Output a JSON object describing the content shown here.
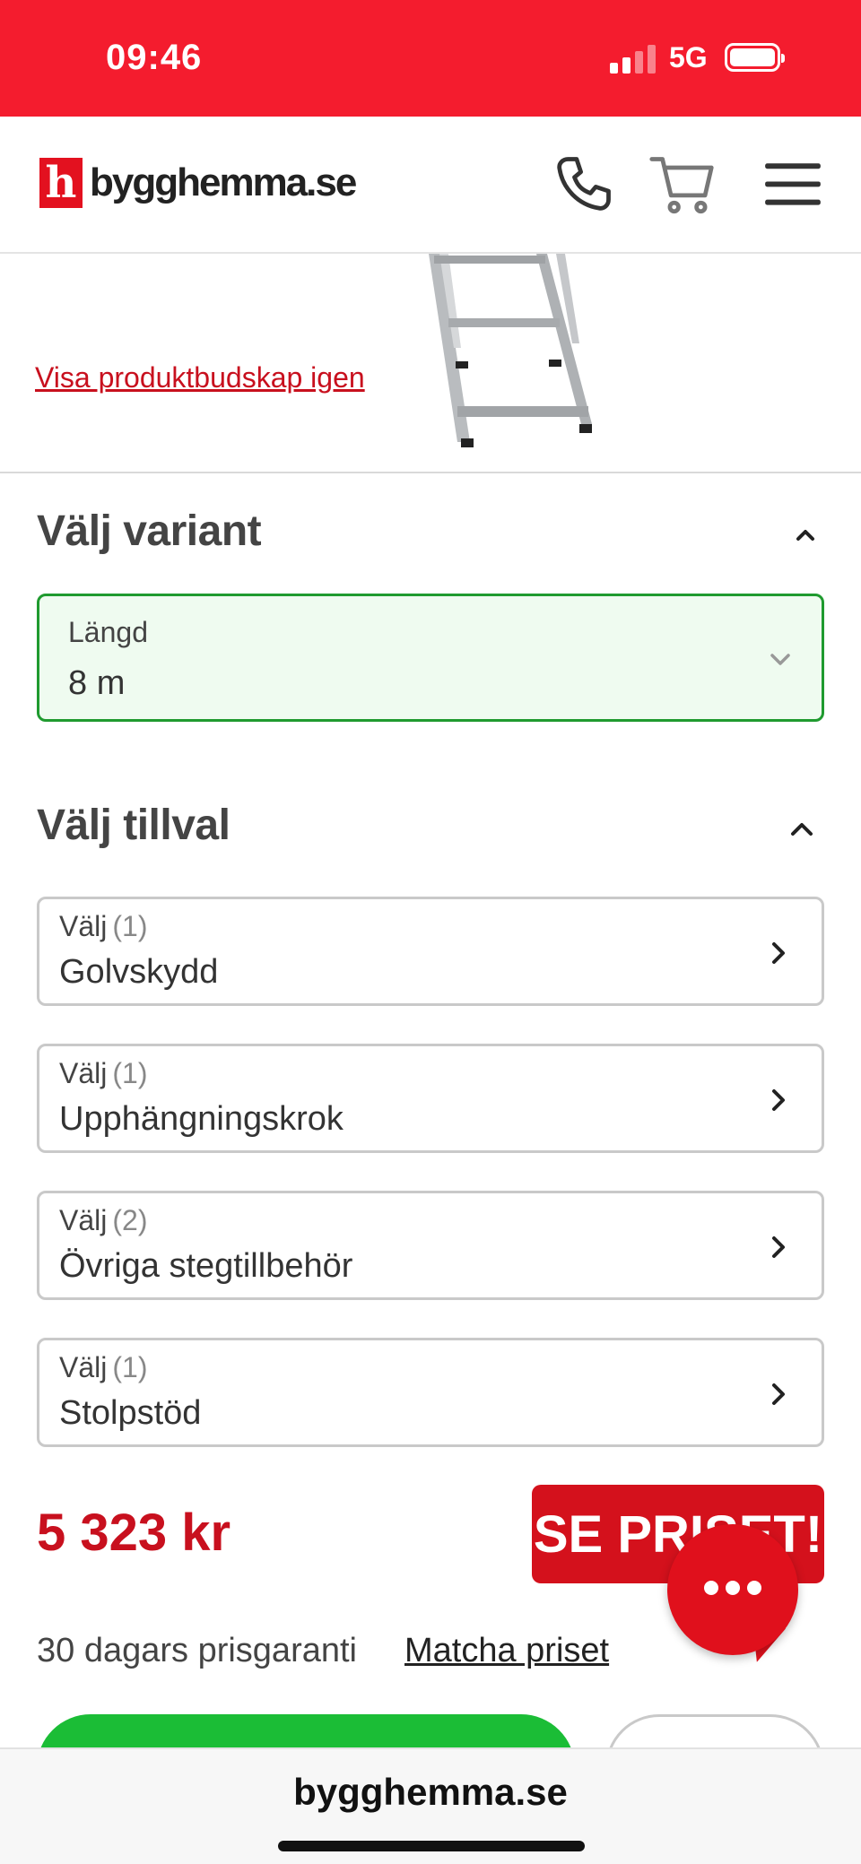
{
  "status_bar": {
    "time": "09:46",
    "network": "5G"
  },
  "header": {
    "logo_mark": "h",
    "logo_text": "bygghemma.se"
  },
  "product": {
    "show_message_link": "Visa produktbudskap igen"
  },
  "variant": {
    "title": "Välj variant",
    "label": "Längd",
    "value": "8 m"
  },
  "options": {
    "title": "Välj tillval",
    "choose_label": "Välj",
    "items": [
      {
        "count": "(1)",
        "name": "Golvskydd"
      },
      {
        "count": "(1)",
        "name": "Upphängningskrok"
      },
      {
        "count": "(2)",
        "name": "Övriga stegtillbehör"
      },
      {
        "count": "(1)",
        "name": "Stolpstöd"
      }
    ]
  },
  "pricing": {
    "price": "5 323 kr",
    "badge": "SE PRISET!",
    "guarantee": "30 dagars prisgaranti",
    "match_link": "Matcha priset"
  },
  "browser": {
    "url": "bygghemma.se"
  },
  "colors": {
    "brand_red": "#f41c2e",
    "price_red": "#c8101e",
    "select_green": "#1f9a2f",
    "cta_green": "#1bbd36"
  }
}
